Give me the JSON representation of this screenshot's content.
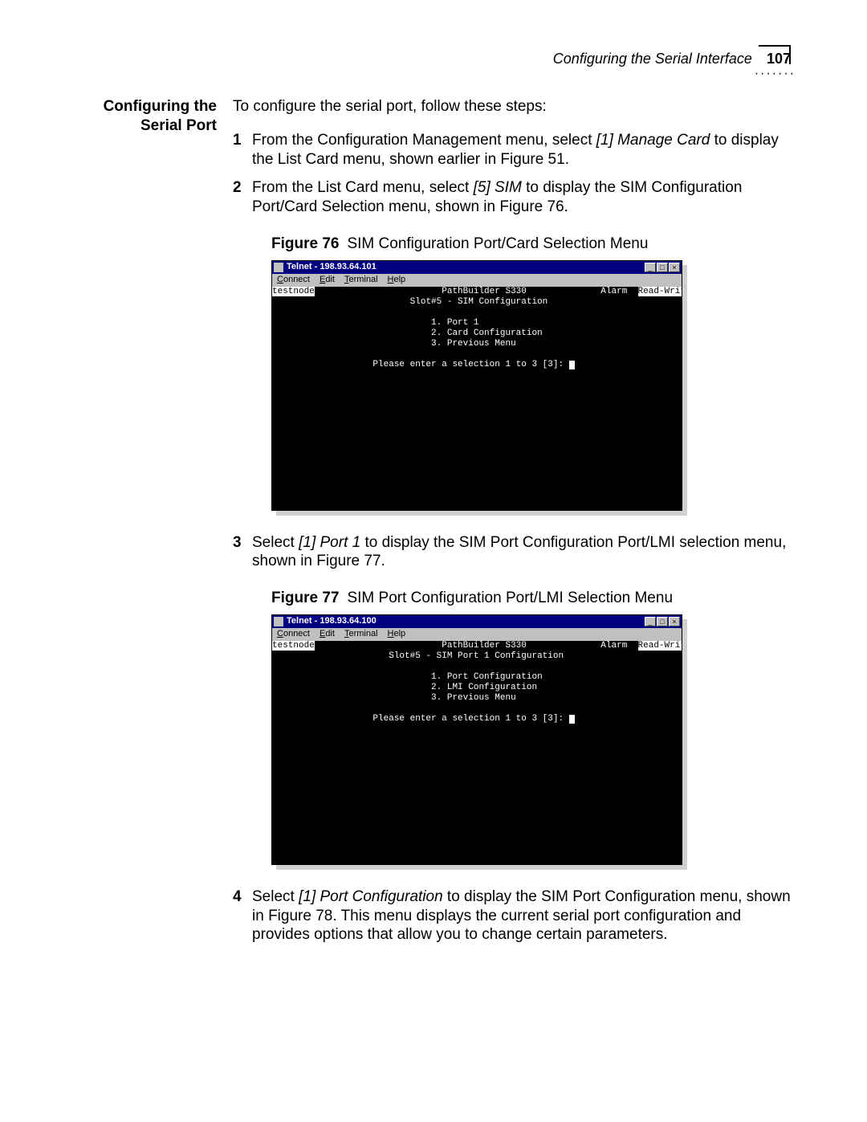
{
  "header": {
    "section_title": "Configuring the Serial Interface",
    "page_number": "107"
  },
  "sidehead": "Configuring the Serial Port",
  "intro": "To configure the serial port, follow these steps:",
  "step1": {
    "pre": "From the Configuration Management menu, select ",
    "em": "[1] Manage Card",
    "post": " to display the List Card menu, shown earlier in Figure 51."
  },
  "step2": {
    "pre": "From the List Card menu, select ",
    "em": "[5] SIM",
    "post": " to display the SIM Configuration Port/Card Selection menu, shown in Figure 76."
  },
  "fig76": {
    "num": "Figure 76",
    "title": "SIM Configuration Port/Card Selection Menu"
  },
  "telnet_menus": {
    "connect": "Connect",
    "edit": "Edit",
    "terminal": "Terminal",
    "help": "Help"
  },
  "win_controls": {
    "min": "_",
    "max": "□",
    "close": "×"
  },
  "telnet1": {
    "title": "Telnet - 198.93.64.101",
    "hostname": "testnode",
    "device": "PathBuilder S330",
    "alarm": "Alarm",
    "mode": "Read-Write",
    "subtitle": "Slot#5 - SIM Configuration",
    "opt1": "1. Port 1",
    "opt2": "2. Card Configuration",
    "opt3": "3. Previous Menu",
    "prompt": "Please enter a selection 1 to 3 [3]: "
  },
  "step3": {
    "pre": "Select ",
    "em": "[1] Port 1",
    "post": " to display the SIM Port Configuration Port/LMI selection menu, shown in Figure 77."
  },
  "fig77": {
    "num": "Figure 77",
    "title": "SIM Port Configuration Port/LMI Selection Menu"
  },
  "telnet2": {
    "title": "Telnet - 198.93.64.100",
    "hostname": "testnode",
    "device": "PathBuilder S330",
    "alarm": "Alarm",
    "mode": "Read-Write",
    "subtitle": "Slot#5 - SIM Port 1 Configuration",
    "opt1": "1. Port Configuration",
    "opt2": "2. LMI Configuration",
    "opt3": "3. Previous Menu",
    "prompt": "Please enter a selection 1 to 3 [3]: "
  },
  "step4": {
    "pre": "Select ",
    "em": "[1] Port Configuration",
    "post": " to display the SIM Port Configuration menu, shown in Figure 78. This menu displays the current serial port configuration and provides options that allow you to change certain parameters."
  }
}
